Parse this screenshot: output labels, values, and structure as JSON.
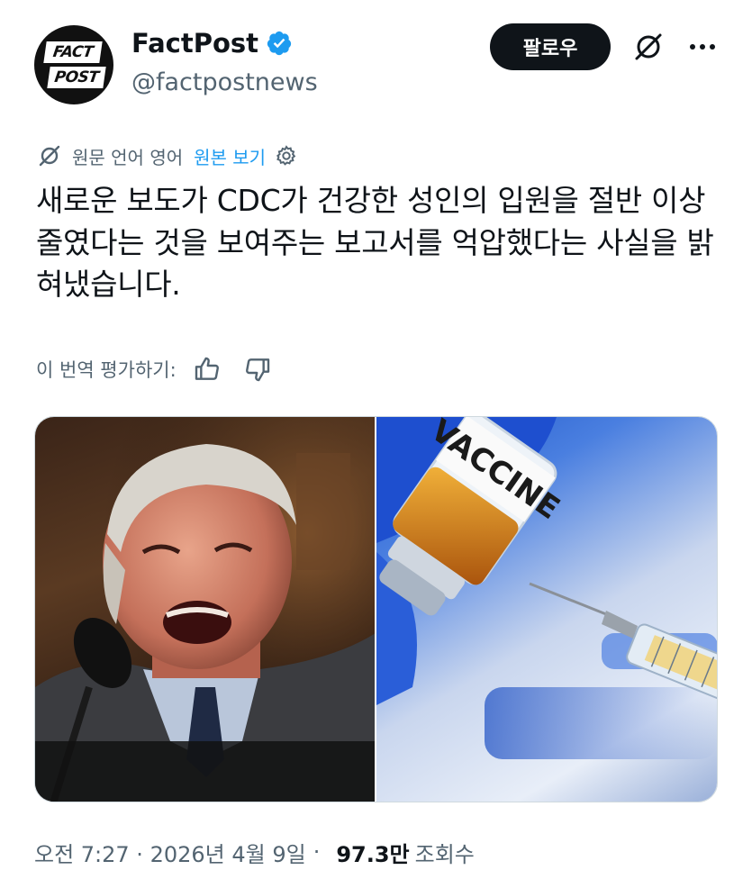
{
  "account": {
    "avatar_logo_top": "FACT",
    "avatar_logo_bottom": "POST",
    "display_name": "FactPost",
    "handle": "@factpostnews",
    "verified": true
  },
  "actions": {
    "follow_label": "팔로우",
    "grok_icon": "grok-icon",
    "more_icon": "more-horizontal-icon"
  },
  "translation": {
    "info_text": "원문 언어 영어",
    "show_original_label": "원본 보기"
  },
  "post": {
    "text": "새로운 보도가 CDC가 건강한 성인의 입원을 절반 이상 줄였다는 것을 보여주는 보고서를 억압했다는 사실을 밝혀냈습니다."
  },
  "rating": {
    "label": "이 번역 평가하기:"
  },
  "media": {
    "images": [
      {
        "subject": "man speaking at microphone"
      },
      {
        "subject": "syringe drawing from vaccine vial",
        "vial_label": "VACCINE"
      }
    ]
  },
  "meta": {
    "time_date": "오전 7:27 · 2026년 4월 9일",
    "views_count": "97.3만",
    "views_label": "조회수"
  },
  "colors": {
    "accent": "#1d9bf0",
    "text_primary": "#0f1419",
    "text_secondary": "#536471",
    "follow_bg": "#0f1419"
  }
}
